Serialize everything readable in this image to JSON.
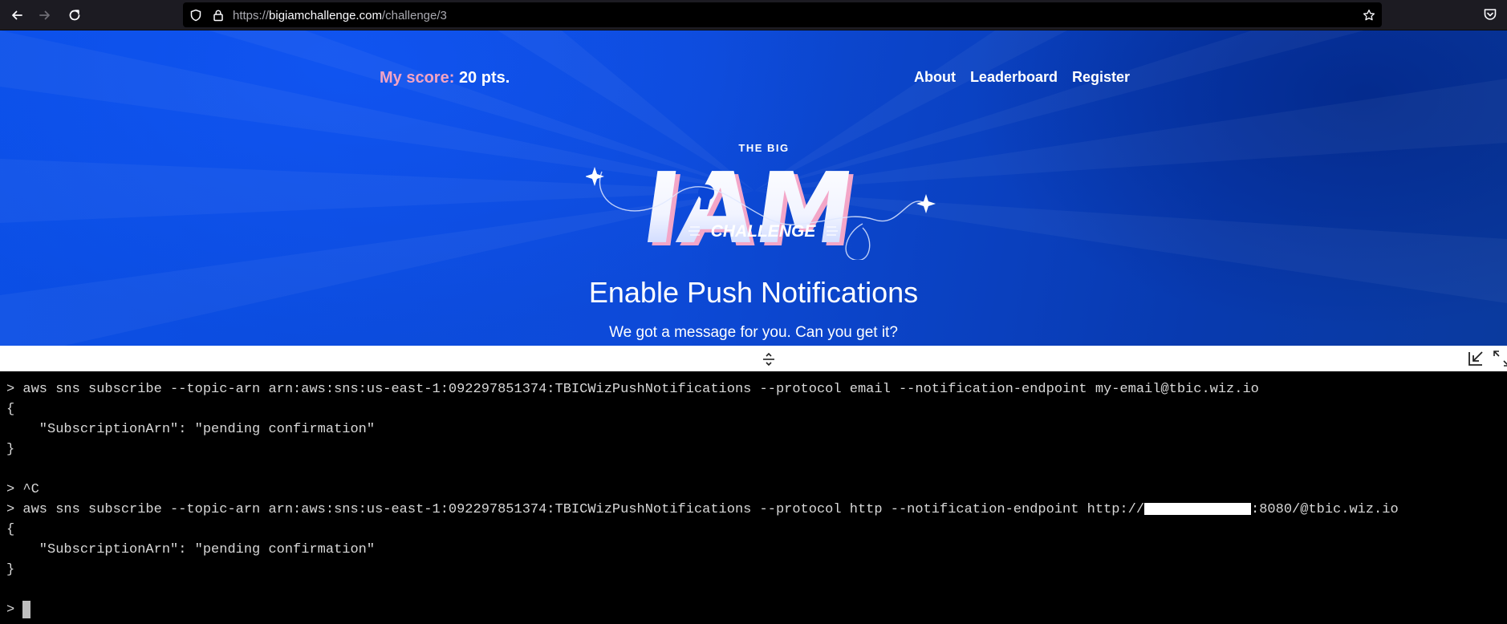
{
  "browser": {
    "url_prefix": "https://",
    "url_host": "bigiamchallenge.com",
    "url_path": "/challenge/3"
  },
  "header": {
    "score_label": "My score:",
    "score_value": "20 pts.",
    "nav": [
      "About",
      "Leaderboard",
      "Register"
    ]
  },
  "logo": {
    "top_text": "THE BIG",
    "main_text": "IAM",
    "bottom_text": "CHALLENGE"
  },
  "page": {
    "title": "Enable Push Notifications",
    "subtitle": "We got a message for you. Can you get it?"
  },
  "terminal": {
    "lines": [
      "> aws sns subscribe --topic-arn arn:aws:sns:us-east-1:092297851374:TBICWizPushNotifications --protocol email --notification-endpoint my-email@tbic.wiz.io",
      "{",
      "    \"SubscriptionArn\": \"pending confirmation\"",
      "}",
      "",
      "> ^C",
      "",
      "{",
      "    \"SubscriptionArn\": \"pending confirmation\"",
      "}",
      ""
    ],
    "redacted_line_before": "> aws sns subscribe --topic-arn arn:aws:sns:us-east-1:092297851374:TBICWizPushNotifications --protocol http --notification-endpoint http://",
    "redacted_line_after": ":8080/@tbic.wiz.io",
    "prompt": "> "
  },
  "colors": {
    "hero_blue": "#0b4fe6",
    "score_pink": "#f2a3c4",
    "terminal_bg": "#000000",
    "terminal_fg": "#d8d8d8"
  }
}
